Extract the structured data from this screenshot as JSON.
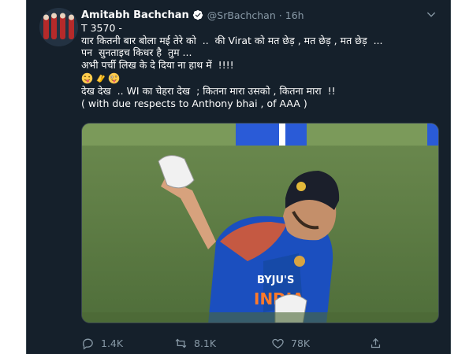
{
  "tweet": {
    "author": {
      "display_name": "Amitabh Bachchan",
      "handle": "@SrBachchan",
      "verified": true,
      "avatar_icon": "profile-photo"
    },
    "separator": "·",
    "timestamp": "16h",
    "text_lines": [
      "T 3570 -",
      "यार कितनी बार बोला मई तेरे को  ..  की Virat को मत छेड़ , मत छेड़ , मत छेड़  ...",
      "पन  सुनताइच किधर है  तुम ...",
      "अभी पर्ची लिख के दे दिया ना हाथ में  !!!!",
      "देख देख  .. WI का चेहरा देख  ; कितना मारा उसको , कितना मारा  !!",
      "( with due respects to Anthony bhai , of AAA )"
    ],
    "emojis": [
      "winking-tongue-face-emoji",
      "clapping-hands-emoji",
      "zany-face-emoji"
    ],
    "media": {
      "kind": "photo",
      "jersey_text": "INDIA",
      "jersey_sponsor": "BYJU'S"
    },
    "actions": {
      "reply_count": "1.4K",
      "retweet_count": "8.1K",
      "like_count": "78K",
      "share_icon": "share-icon"
    }
  },
  "colors": {
    "background": "#15202b",
    "text": "#ffffff",
    "secondary_text": "#8899a6",
    "verified_badge": "#ffffff",
    "border": "#38444d"
  }
}
